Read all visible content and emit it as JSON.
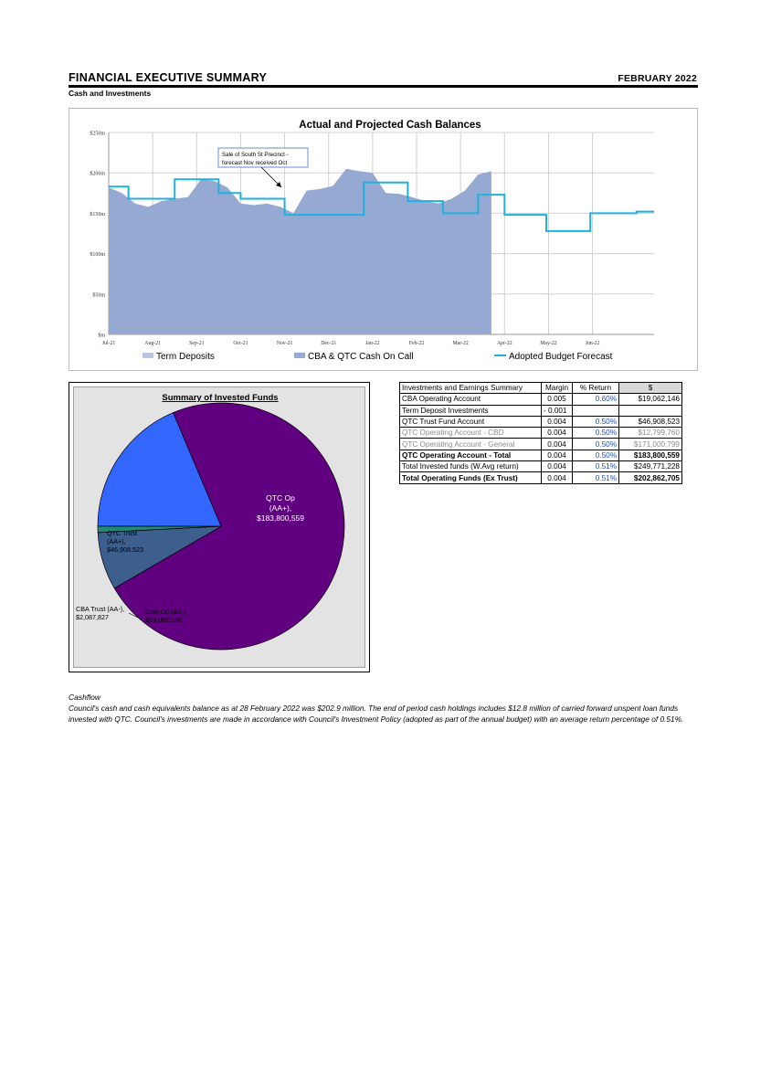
{
  "header": {
    "title": "FINANCIAL EXECUTIVE SUMMARY",
    "date": "FEBRUARY 2022",
    "subtitle": "Cash and Investments"
  },
  "chart_data": [
    {
      "type": "area",
      "title": "Actual and Projected Cash Balances",
      "y_ticks": [
        "$m",
        "$50m",
        "$100m",
        "$150m",
        "$200m",
        "$250m"
      ],
      "ylim": [
        0,
        250
      ],
      "x_ticks": [
        "Jul-21",
        "Aug-21",
        "Sep-21",
        "Oct-21",
        "Nov-21",
        "Dec-21",
        "Jan-22",
        "Feb-22",
        "Mar-22",
        "Apr-22",
        "May-22",
        "Jun-22"
      ],
      "grid": true,
      "legend_position": "bottom",
      "legend": [
        "Term Deposits",
        "CBA & QTC Cash On Call",
        "Adopted Budget Forecast"
      ],
      "colors": {
        "term_deposits": "#b8c6e4",
        "cash_on_call": "#95a9d2",
        "budget": "#1fb0de"
      },
      "annotation": "Sale of South St Precinct - forecast Nov received Oct",
      "series": [
        {
          "name": "CBA & QTC Cash On Call",
          "x": [
            0,
            0.3,
            0.6,
            0.9,
            1.2,
            1.5,
            1.8,
            2.1,
            2.4,
            2.7,
            3.0,
            3.3,
            3.6,
            3.9,
            4.2,
            4.5,
            4.8,
            5.1,
            5.4,
            5.7,
            6.0,
            6.3,
            6.6,
            6.9,
            7.2,
            7.5,
            7.8,
            8.1,
            8.4,
            8.7
          ],
          "values": [
            182,
            175,
            162,
            158,
            165,
            168,
            170,
            192,
            190,
            182,
            162,
            160,
            162,
            158,
            150,
            178,
            180,
            184,
            205,
            202,
            200,
            175,
            174,
            170,
            165,
            162,
            168,
            178,
            198,
            202
          ]
        },
        {
          "name": "Adopted Budget Forecast",
          "x": [
            0,
            0.45,
            0.45,
            1.5,
            1.5,
            2.5,
            2.5,
            3.0,
            3.0,
            4.0,
            4.0,
            4.8,
            4.8,
            5.8,
            5.8,
            6.8,
            6.8,
            7.6,
            7.6,
            8.4,
            8.4,
            9.0,
            9.0,
            9.95,
            9.95,
            10.95,
            10.95,
            12.0,
            12.0,
            12.4
          ],
          "values": [
            183,
            183,
            168,
            168,
            192,
            192,
            175,
            175,
            168,
            168,
            148,
            148,
            148,
            148,
            188,
            188,
            165,
            165,
            150,
            150,
            173,
            173,
            148,
            148,
            128,
            128,
            150,
            150,
            152,
            152
          ]
        }
      ]
    },
    {
      "type": "pie",
      "title": "Summary of Invested Funds",
      "slices": [
        {
          "label": "QTC Op",
          "rating": "(AA+),",
          "amount": "$183,800,559",
          "value": 183800559,
          "color": "#600080"
        },
        {
          "label": "CBA Op (AA-),",
          "amount": "$19,062,146",
          "value": 19062146,
          "color": "#3c5f8e"
        },
        {
          "label": "CBA Trust (AA-),",
          "amount": "$2,087,827",
          "value": 2087827,
          "color": "#1f8a7a"
        },
        {
          "label": "QTC Trust",
          "rating": "(AA+),",
          "amount": "$46,908,523",
          "value": 46908523,
          "color": "#3366ff"
        }
      ]
    }
  ],
  "table": {
    "headers": [
      "Investments and Earnings Summary",
      "Margin",
      "% Return",
      "$"
    ],
    "rows": [
      [
        "CBA Operating Account",
        "0.005",
        "0.60%",
        "$19,062,146"
      ],
      [
        "Term Deposit Investments",
        "- 0.001",
        "",
        ""
      ],
      [
        "QTC Trust Fund Account",
        "0.004",
        "0.50%",
        "$46,908,523"
      ],
      [
        "QTC Operating Account - CBD",
        "0.004",
        "0.50%",
        "$12,799,760"
      ],
      [
        "QTC Operating Account - General",
        "0.004",
        "0.50%",
        "$171,000,799"
      ],
      [
        "QTC Operating Account - Total",
        "0.004",
        "0.50%",
        "$183,800,559"
      ],
      [
        "Total Invested funds (W.Avg return)",
        "0.004",
        "0.51%",
        "$249,771,228"
      ],
      [
        "Total Operating Funds (Ex Trust)",
        "0.004",
        "0.51%",
        "$202,862,705"
      ]
    ]
  },
  "cashflow": {
    "title": "Cashflow",
    "text": "Council's cash and cash equivalents balance as at 28 February 2022 was $202.9 million. The end of period cash holdings includes $12.8 million of carried forward unspent loan funds invested with QTC. Council's investments are made in accordance with Council's Investment Policy (adopted as part of the annual budget) with an average return percentage of 0.51%."
  }
}
